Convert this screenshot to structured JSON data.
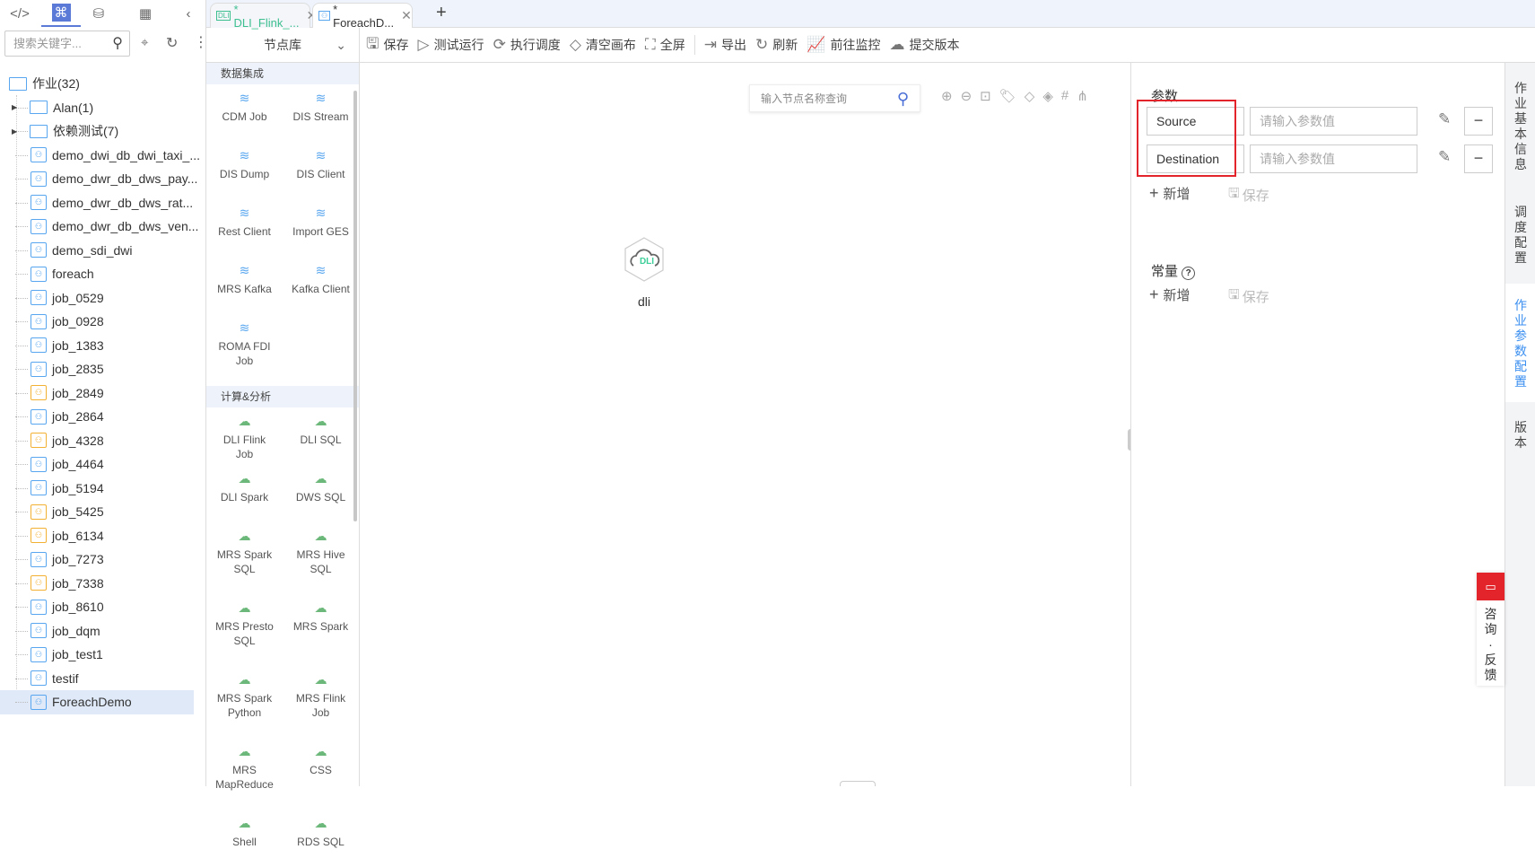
{
  "left_tabs": [
    {
      "icon": "code-icon"
    },
    {
      "icon": "flow-icon"
    },
    {
      "icon": "database-icon"
    },
    {
      "icon": "table-icon"
    }
  ],
  "search": {
    "placeholder": "搜索关键字..."
  },
  "tree": {
    "root": "作业(32)",
    "folders": [
      "Alan(1)",
      "依赖测试(7)"
    ],
    "jobs": [
      {
        "name": "demo_dwi_db_dwi_taxi_...",
        "color": "blue"
      },
      {
        "name": "demo_dwr_db_dws_pay...",
        "color": "blue"
      },
      {
        "name": "demo_dwr_db_dws_rat...",
        "color": "blue"
      },
      {
        "name": "demo_dwr_db_dws_ven...",
        "color": "blue"
      },
      {
        "name": "demo_sdi_dwi",
        "color": "blue"
      },
      {
        "name": "foreach",
        "color": "blue"
      },
      {
        "name": "job_0529",
        "color": "blue"
      },
      {
        "name": "job_0928",
        "color": "blue"
      },
      {
        "name": "job_1383",
        "color": "blue"
      },
      {
        "name": "job_2835",
        "color": "blue"
      },
      {
        "name": "job_2849",
        "color": "yellow"
      },
      {
        "name": "job_2864",
        "color": "blue"
      },
      {
        "name": "job_4328",
        "color": "yellow"
      },
      {
        "name": "job_4464",
        "color": "blue"
      },
      {
        "name": "job_5194",
        "color": "blue"
      },
      {
        "name": "job_5425",
        "color": "yellow"
      },
      {
        "name": "job_6134",
        "color": "yellow"
      },
      {
        "name": "job_7273",
        "color": "blue"
      },
      {
        "name": "job_7338",
        "color": "yellow"
      },
      {
        "name": "job_8610",
        "color": "blue"
      },
      {
        "name": "job_dqm",
        "color": "blue"
      },
      {
        "name": "job_test1",
        "color": "blue"
      },
      {
        "name": "testif",
        "color": "blue"
      },
      {
        "name": "ForeachDemo",
        "color": "blue",
        "selected": true
      }
    ]
  },
  "tabs": [
    {
      "label": "* DLI_Flink_...",
      "active": false,
      "color": "#3dbf8f"
    },
    {
      "label": "* ForeachD...",
      "active": true,
      "color": "#333333"
    }
  ],
  "library": {
    "title": "节点库",
    "sections": [
      {
        "title": "数据集成",
        "color": "blue",
        "nodes": [
          "CDM Job",
          "DIS Stream",
          "DIS Dump",
          "DIS Client",
          "Rest Client",
          "Import GES",
          "MRS Kafka",
          "Kafka Client",
          "ROMA FDI Job"
        ]
      },
      {
        "title": "计算&分析",
        "color": "green",
        "nodes": [
          "DLI Flink Job",
          "DLI SQL",
          "DLI Spark",
          "DWS SQL",
          "MRS Spark SQL",
          "MRS Hive SQL",
          "MRS Presto SQL",
          "MRS Spark",
          "MRS Spark Python",
          "MRS Flink Job",
          "MRS MapReduce",
          "CSS",
          "Shell",
          "RDS SQL"
        ]
      }
    ]
  },
  "toolbar": [
    "保存",
    "测试运行",
    "执行调度",
    "清空画布",
    "全屏",
    "导出",
    "刷新",
    "前往监控",
    "提交版本"
  ],
  "canvas": {
    "search_placeholder": "输入节点名称查询",
    "node": {
      "label": "dli",
      "badge": "DLI"
    }
  },
  "params": {
    "title": "参数",
    "rows": [
      {
        "name": "Source",
        "placeholder": "请输入参数值"
      },
      {
        "name": "Destination",
        "placeholder": "请输入参数值"
      }
    ],
    "add": "新增",
    "save": "保存",
    "const_title": "常量",
    "const_add": "新增",
    "const_save": "保存"
  },
  "right_tabs": [
    {
      "label": "作业基本信息"
    },
    {
      "label": "调度配置"
    },
    {
      "label": "作业参数配置",
      "active": true
    },
    {
      "label": "版本"
    }
  ],
  "feedback": "咨询·反馈"
}
